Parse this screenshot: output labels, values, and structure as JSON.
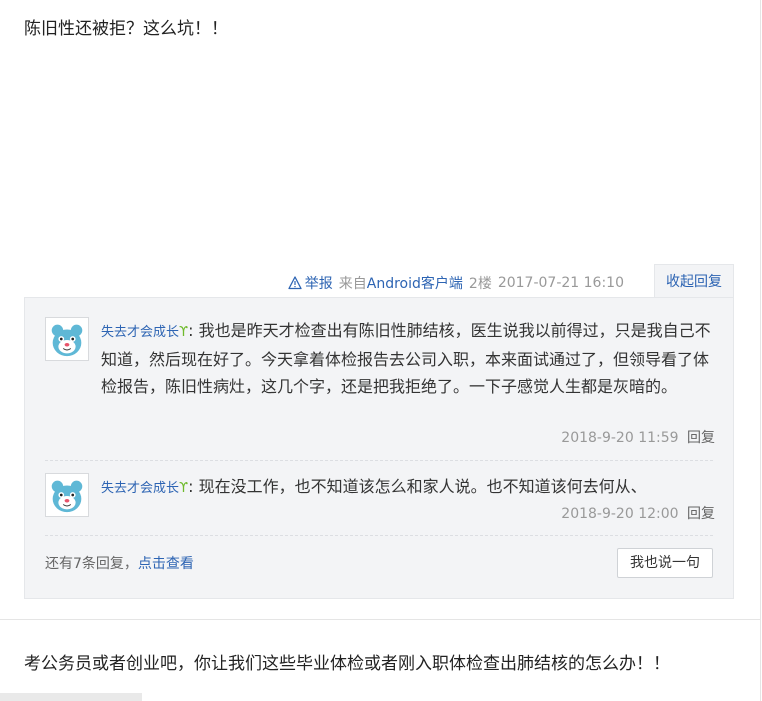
{
  "post1": {
    "text": "陈旧性还被拒？这么坑！！"
  },
  "meta": {
    "report_label": "举报",
    "source_prefix": "来自",
    "source_link": "Android客户端",
    "floor": "2楼",
    "time": "2017-07-21 16:10",
    "collapse_label": "收起回复"
  },
  "replies": [
    {
      "username": "失去才会成长",
      "text": "我也是昨天才检查出有陈旧性肺结核，医生说我以前得过，只是我自己不知道，然后现在好了。今天拿着体检报告去公司入职，本来面试通过了，但领导看了体检报告，陈旧性病灶，这几个字，还是把我拒绝了。一下子感觉人生都是灰暗的。",
      "time": "2018-9-20 11:59",
      "reply_label": "回复"
    },
    {
      "username": "失去才会成长",
      "text": "现在没工作，也不知道该怎么和家人说。也不知道该何去何从、",
      "time": "2018-9-20 12:00",
      "reply_label": "回复"
    }
  ],
  "more": {
    "prefix": "还有7条回复，",
    "link": "点击查看"
  },
  "say_button": "我也说一句",
  "post2": {
    "text": "考公务员或者创业吧，你让我们这些毕业体检或者刚入职体检查出肺结核的怎么办！！"
  },
  "colors": {
    "link": "#2d64b3",
    "sprout": "#6fba2c",
    "reply_bg": "#f3f4f6"
  },
  "icons": {
    "report": "warning-triangle-icon",
    "avatar": "cartoon-bear-avatar",
    "sprout": "sprout-icon"
  }
}
